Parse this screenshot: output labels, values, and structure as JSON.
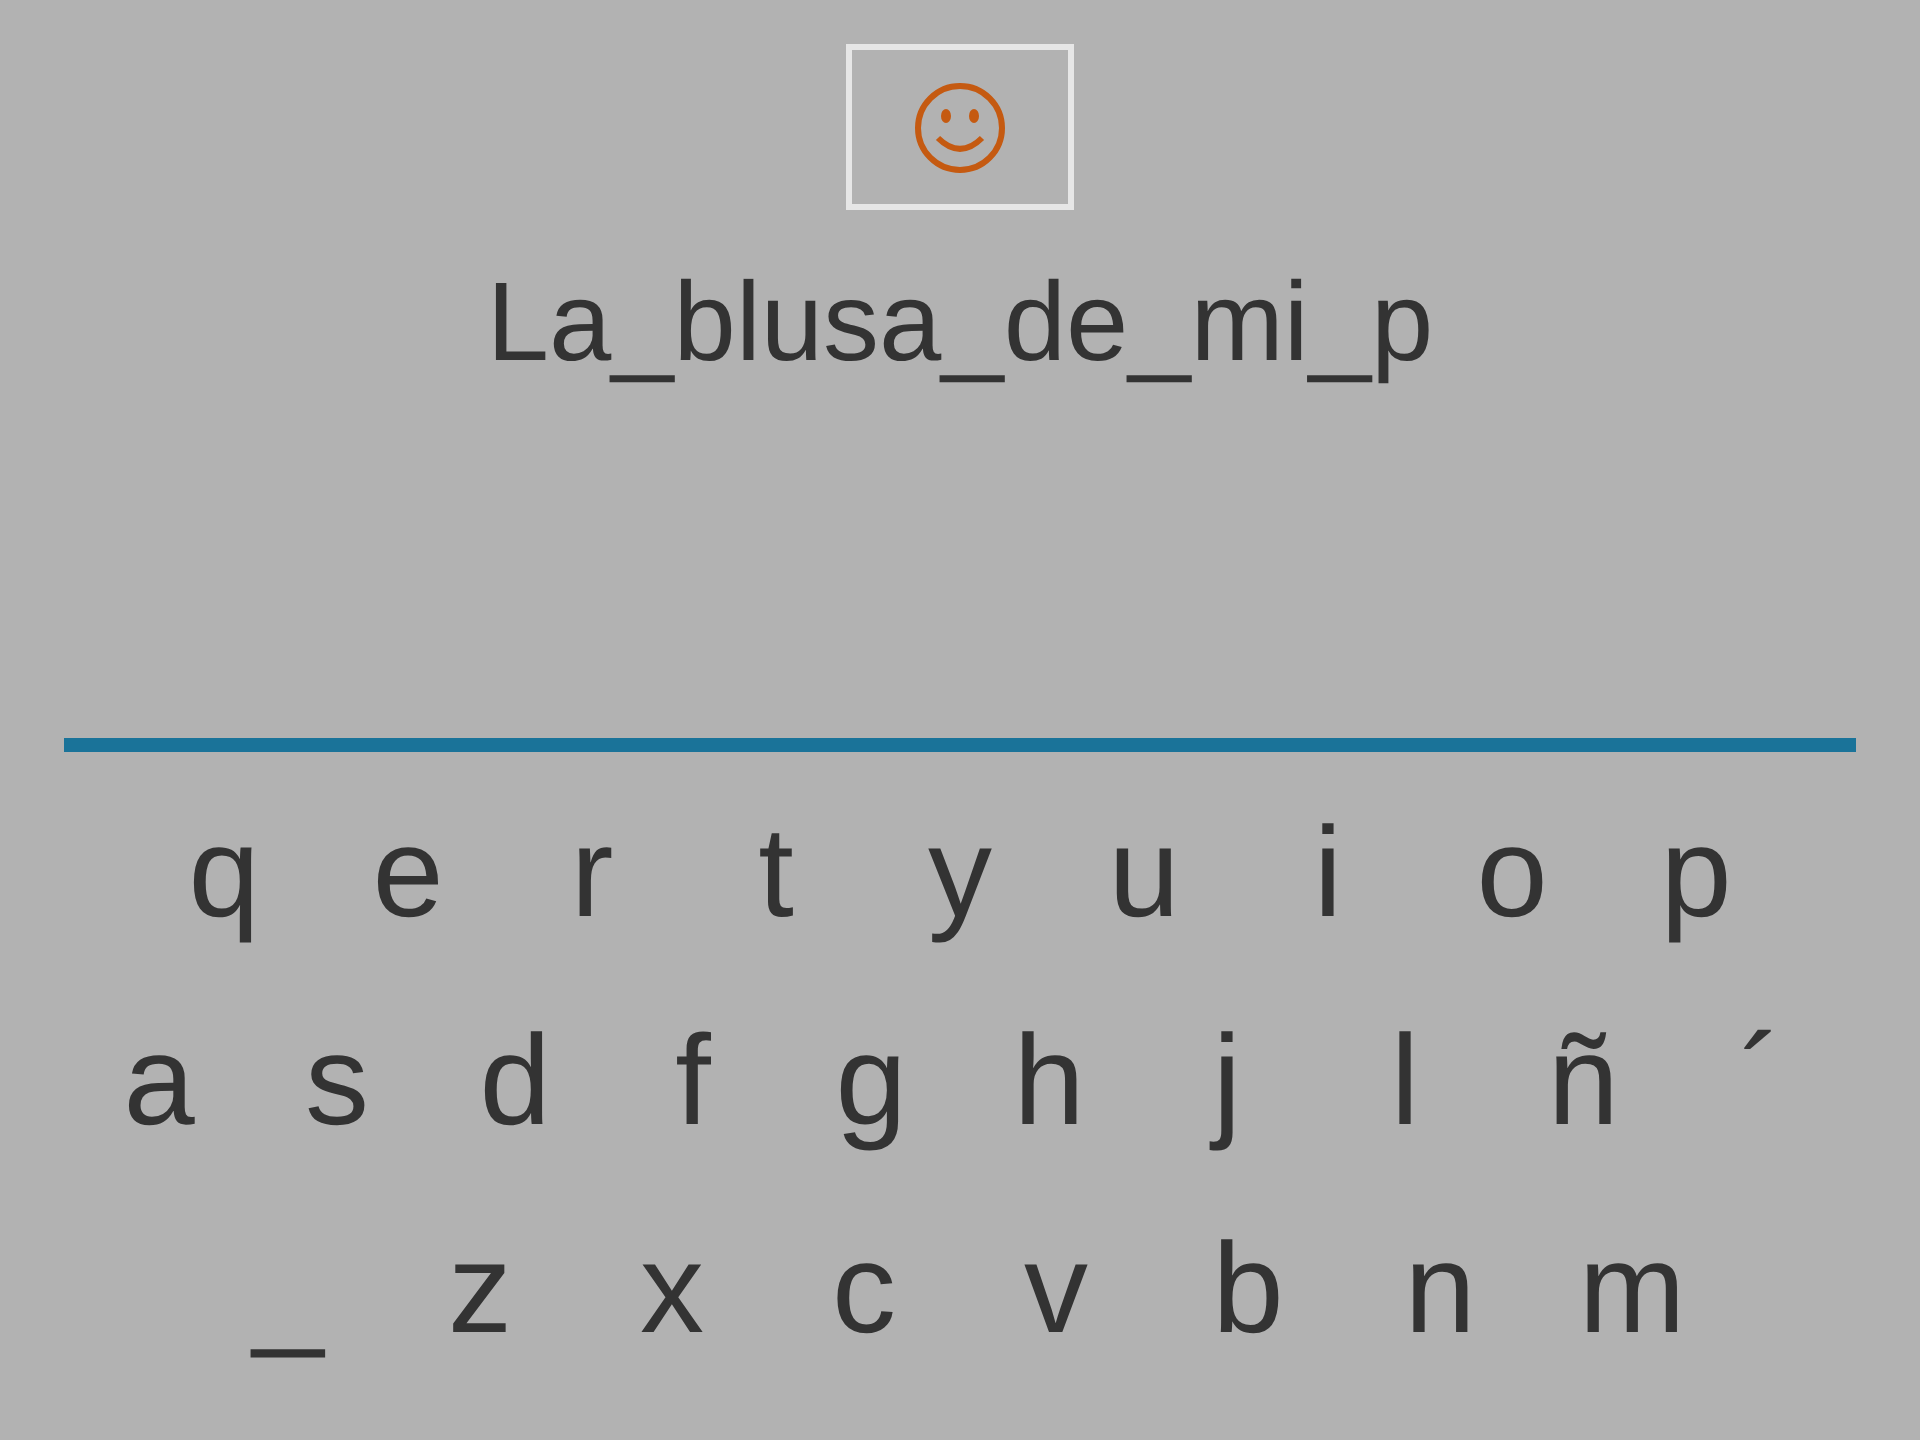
{
  "prompt": "La_blusa_de_mi_p",
  "keyboard": {
    "rows": [
      [
        "q",
        "e",
        "r",
        "t",
        "y",
        "u",
        "i",
        "o",
        "p"
      ],
      [
        "a",
        "s",
        "d",
        "f",
        "g",
        "h",
        "j",
        "l",
        "ñ",
        "´"
      ],
      [
        "_",
        "z",
        "x",
        "c",
        "v",
        "b",
        "n",
        "m"
      ]
    ]
  }
}
